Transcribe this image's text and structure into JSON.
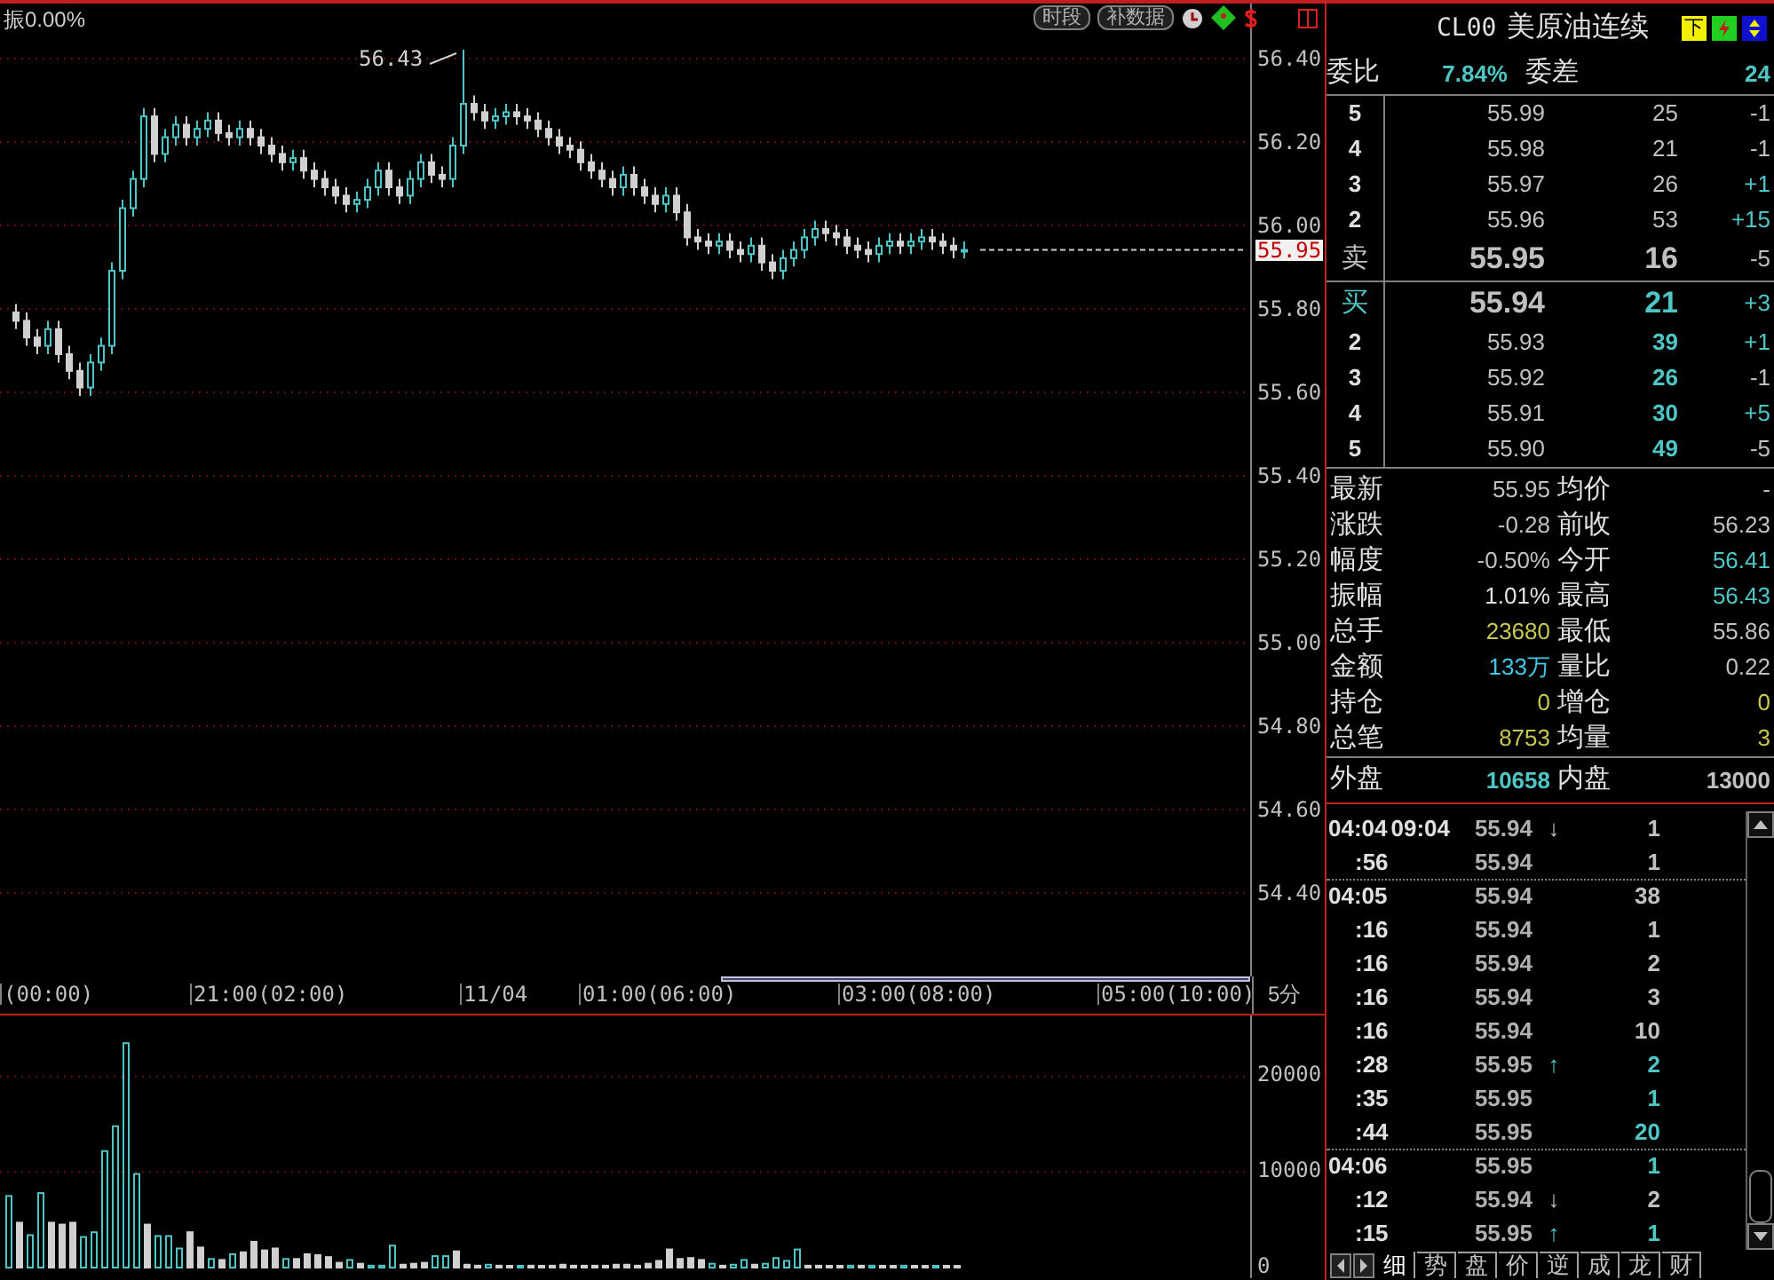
{
  "chart_header": {
    "amplitude": "振0.00%",
    "high_label": "56.43",
    "current_price": "55.95"
  },
  "toolbar": {
    "buttons": [
      "时段",
      "补数据"
    ]
  },
  "price_axis": {
    "ticks": [
      "56.40",
      "56.20",
      "56.00",
      "55.80",
      "55.60",
      "55.40",
      "55.20",
      "55.00",
      "54.80",
      "54.60",
      "54.40"
    ]
  },
  "time_axis": {
    "labels": [
      "(00:00)",
      "21:00(02:00)",
      "11/04",
      "01:00(06:00)",
      "03:00(08:00)",
      "05:00(10:00)"
    ],
    "period": "5分"
  },
  "volume_axis": {
    "ticks": [
      "20000",
      "10000",
      "0"
    ]
  },
  "quote": {
    "symbol": "CL00",
    "name": "美原油连续",
    "badge": "下",
    "ratio_label": "委比",
    "ratio": "7.84%",
    "diff_label": "委差",
    "diff": "24",
    "asks": [
      {
        "kind": "level",
        "level": "5",
        "price": "55.99",
        "volume": "25",
        "change": "-1",
        "rising": false
      },
      {
        "kind": "level",
        "level": "4",
        "price": "55.98",
        "volume": "21",
        "change": "-1",
        "rising": false
      },
      {
        "kind": "level",
        "level": "3",
        "price": "55.97",
        "volume": "26",
        "change": "+1",
        "rising": true
      },
      {
        "kind": "level",
        "level": "2",
        "price": "55.96",
        "volume": "53",
        "change": "+15",
        "rising": true
      },
      {
        "kind": "best",
        "level": "卖",
        "price": "55.95",
        "volume": "16",
        "change": "-5",
        "rising": false
      }
    ],
    "bids": [
      {
        "kind": "best",
        "level": "买",
        "price": "55.94",
        "volume": "21",
        "change": "+3",
        "rising": true
      },
      {
        "kind": "level",
        "level": "2",
        "price": "55.93",
        "volume": "39",
        "change": "+1",
        "rising": true
      },
      {
        "kind": "level",
        "level": "3",
        "price": "55.92",
        "volume": "26",
        "change": "-1",
        "rising": false
      },
      {
        "kind": "level",
        "level": "4",
        "price": "55.91",
        "volume": "30",
        "change": "+5",
        "rising": true
      },
      {
        "kind": "level",
        "level": "5",
        "price": "55.90",
        "volume": "49",
        "change": "-5",
        "rising": false
      }
    ],
    "stats": [
      {
        "label": "最新",
        "value": "55.95",
        "color": "#c0c0c0"
      },
      {
        "label": "均价",
        "value": "-",
        "color": "#c0c0c0"
      },
      {
        "label": "涨跌",
        "value": "-0.28",
        "color": "#c0c0c0"
      },
      {
        "label": "前收",
        "value": "56.23",
        "color": "#c0c0c0"
      },
      {
        "label": "幅度",
        "value": "-0.50%",
        "color": "#c0c0c0"
      },
      {
        "label": "今开",
        "value": "56.41",
        "color": "#4ec6c6"
      },
      {
        "label": "振幅",
        "value": "1.01%",
        "color": "#e0e0e0"
      },
      {
        "label": "最高",
        "value": "56.43",
        "color": "#4ec6c6"
      },
      {
        "label": "总手",
        "value": "23680",
        "color": "#c8c850"
      },
      {
        "label": "最低",
        "value": "55.86",
        "color": "#c0c0c0"
      },
      {
        "label": "金额",
        "value": "133万",
        "color": "#40c8e8"
      },
      {
        "label": "量比",
        "value": "0.22",
        "color": "#c0c0c0"
      },
      {
        "label": "持仓",
        "value": "0",
        "color": "#c8c850"
      },
      {
        "label": "增仓",
        "value": "0",
        "color": "#c8c850"
      },
      {
        "label": "总笔",
        "value": "8753",
        "color": "#c8c850"
      },
      {
        "label": "均量",
        "value": "3",
        "color": "#c8c850"
      }
    ],
    "outer_inner": [
      {
        "label": "外盘",
        "value": "10658",
        "color": "#4ec6c6"
      },
      {
        "label": "内盘",
        "value": "13000",
        "color": "#c0c0c0"
      }
    ]
  },
  "ticks": [
    {
      "time": "04:04",
      "time2": "09:04",
      "minute_start": true,
      "divider_above": false,
      "price": "55.94",
      "arrow": "↓",
      "color": "#c0c0c0",
      "volume": "1"
    },
    {
      "time": ":56",
      "minute_start": false,
      "divider_above": false,
      "price": "55.94",
      "color": "#c0c0c0",
      "volume": "1"
    },
    {
      "time": "04:05",
      "minute_start": true,
      "divider_above": true,
      "price": "55.94",
      "color": "#c0c0c0",
      "volume": "38"
    },
    {
      "time": ":16",
      "minute_start": false,
      "divider_above": false,
      "price": "55.94",
      "color": "#c0c0c0",
      "volume": "1"
    },
    {
      "time": ":16",
      "minute_start": false,
      "divider_above": false,
      "price": "55.94",
      "color": "#c0c0c0",
      "volume": "2"
    },
    {
      "time": ":16",
      "minute_start": false,
      "divider_above": false,
      "price": "55.94",
      "color": "#c0c0c0",
      "volume": "3"
    },
    {
      "time": ":16",
      "minute_start": false,
      "divider_above": false,
      "price": "55.94",
      "color": "#c0c0c0",
      "volume": "10"
    },
    {
      "time": ":28",
      "minute_start": false,
      "divider_above": false,
      "price": "55.95",
      "arrow": "↑",
      "color": "#4ec6c6",
      "volume": "2"
    },
    {
      "time": ":35",
      "minute_start": false,
      "divider_above": false,
      "price": "55.95",
      "color": "#4ec6c6",
      "volume": "1"
    },
    {
      "time": ":44",
      "minute_start": false,
      "divider_above": false,
      "price": "55.95",
      "color": "#4ec6c6",
      "volume": "20"
    },
    {
      "time": "04:06",
      "minute_start": true,
      "divider_above": true,
      "price": "55.95",
      "color": "#4ec6c6",
      "volume": "1"
    },
    {
      "time": ":12",
      "minute_start": false,
      "divider_above": false,
      "price": "55.94",
      "arrow": "↓",
      "color": "#c0c0c0",
      "volume": "2"
    },
    {
      "time": ":15",
      "minute_start": false,
      "divider_above": false,
      "price": "55.95",
      "arrow": "↑",
      "color": "#4ec6c6",
      "volume": "1"
    }
  ],
  "tabs": [
    {
      "label": "细",
      "selected": true
    },
    {
      "label": "势",
      "selected": false
    },
    {
      "label": "盘",
      "selected": false
    },
    {
      "label": "价",
      "selected": false
    },
    {
      "label": "逆",
      "selected": false
    },
    {
      "label": "成",
      "selected": false
    },
    {
      "label": "龙",
      "selected": false
    },
    {
      "label": "财",
      "selected": false
    }
  ]
}
